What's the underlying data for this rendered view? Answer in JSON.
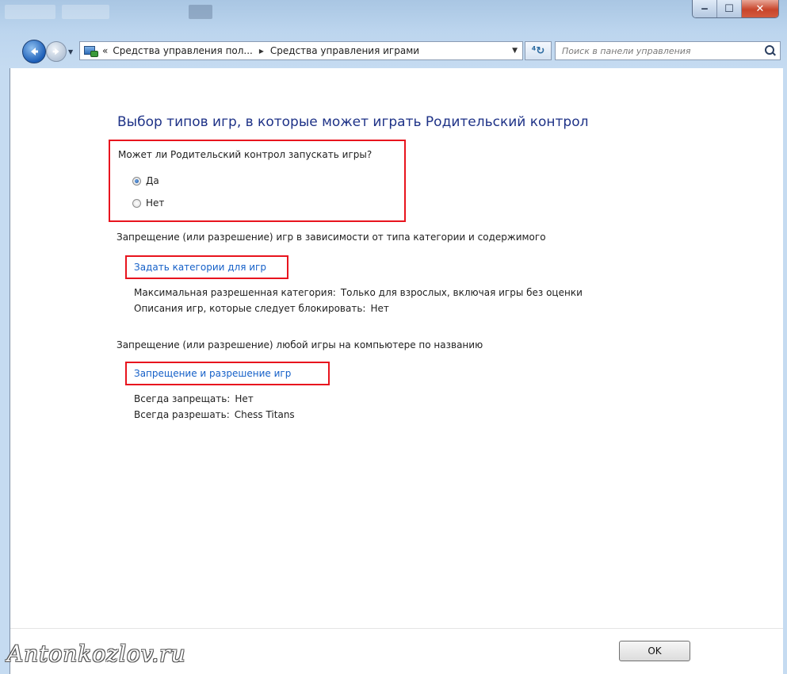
{
  "navigation": {
    "breadcrumb_prefix": "«",
    "breadcrumbs": [
      "Средства управления пол...",
      "Средства управления играми"
    ],
    "breadcrumb_separator": "▸",
    "search_placeholder": "Поиск в панели управления"
  },
  "page": {
    "title": "Выбор типов игр, в которые может играть Родительский контрол",
    "question": "Может ли Родительский контрол запускать игры?",
    "radio_options": [
      {
        "label": "Да",
        "checked": true
      },
      {
        "label": "Нет",
        "checked": false
      }
    ],
    "category_section": {
      "heading": "Запрещение (или разрешение) игр в зависимости от типа категории и содержимого",
      "link": "Задать категории для игр",
      "max_category_label": "Максимальная разрешенная категория:",
      "max_category_value": "Только для взрослых, включая игры без оценки",
      "block_desc_label": "Описания игр, которые следует блокировать:",
      "block_desc_value": "Нет"
    },
    "name_section": {
      "heading": "Запрещение (или разрешение) любой игры на компьютере по названию",
      "link": "Запрещение и разрешение игр",
      "always_block_label": "Всегда запрещать:",
      "always_block_value": "Нет",
      "always_allow_label": "Всегда разрешать:",
      "always_allow_value": "Chess Titans"
    },
    "ok_label": "OK"
  },
  "watermark": "Antonkozlov.ru",
  "colors": {
    "title": "#1e3287",
    "link": "#1560c8",
    "highlight": "#e8141e"
  }
}
